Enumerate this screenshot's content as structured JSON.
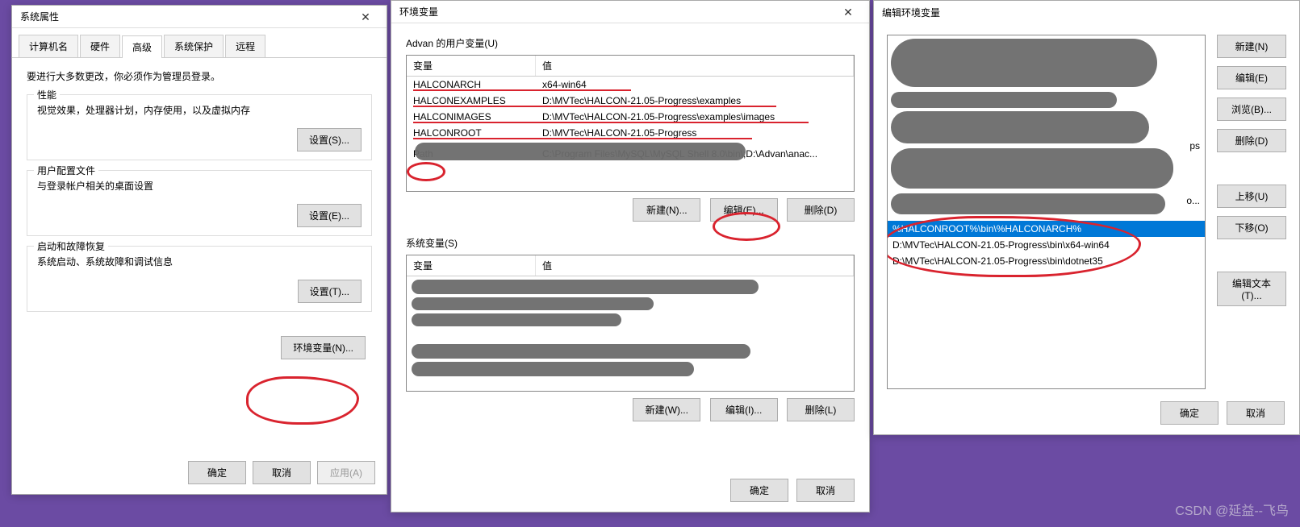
{
  "d1": {
    "title": "系统属性",
    "tabs": [
      "计算机名",
      "硬件",
      "高级",
      "系统保护",
      "远程"
    ],
    "intro": "要进行大多数更改，你必须作为管理员登录。",
    "perf": {
      "label": "性能",
      "desc": "视觉效果，处理器计划，内存使用，以及虚拟内存",
      "btn": "设置(S)..."
    },
    "profile": {
      "label": "用户配置文件",
      "desc": "与登录帐户相关的桌面设置",
      "btn": "设置(E)..."
    },
    "startup": {
      "label": "启动和故障恢复",
      "desc": "系统启动、系统故障和调试信息",
      "btn": "设置(T)..."
    },
    "env_btn": "环境变量(N)...",
    "ok": "确定",
    "cancel": "取消",
    "apply": "应用(A)"
  },
  "d2": {
    "title": "环境变量",
    "user_label": "Advan 的用户变量(U)",
    "col_name": "变量",
    "col_value": "值",
    "user_vars": [
      {
        "name": "HALCONARCH",
        "value": "x64-win64"
      },
      {
        "name": "HALCONEXAMPLES",
        "value": "D:\\MVTec\\HALCON-21.05-Progress\\examples"
      },
      {
        "name": "HALCONIMAGES",
        "value": "D:\\MVTec\\HALCON-21.05-Progress\\examples\\images"
      },
      {
        "name": "HALCONROOT",
        "value": "D:\\MVTec\\HALCON-21.05-Progress"
      },
      {
        "name": "",
        "value": ""
      },
      {
        "name": "Path",
        "value": "C:\\Program Files\\MySQL\\MySQL Shell 8.0\\bin\\;D:\\Advan\\anac..."
      }
    ],
    "btns_user": {
      "new": "新建(N)...",
      "edit": "编辑(E)...",
      "delete": "删除(D)"
    },
    "sys_label": "系统变量(S)",
    "btns_sys": {
      "new": "新建(W)...",
      "edit": "编辑(I)...",
      "delete": "删除(L)"
    },
    "ok": "确定",
    "cancel": "取消"
  },
  "d3": {
    "title": "编辑环境变量",
    "paths_visible_suffix": [
      "ps",
      "o..."
    ],
    "paths_full": [
      "%HALCONROOT%\\bin\\%HALCONARCH%",
      "D:\\MVTec\\HALCON-21.05-Progress\\bin\\x64-win64",
      "D:\\MVTec\\HALCON-21.05-Progress\\bin\\dotnet35"
    ],
    "btns": {
      "new": "新建(N)",
      "edit": "编辑(E)",
      "browse": "浏览(B)...",
      "delete": "删除(D)",
      "up": "上移(U)",
      "down": "下移(O)",
      "edittext": "编辑文本(T)..."
    },
    "ok": "确定",
    "cancel": "取消"
  },
  "watermark": "CSDN @延益--飞鸟"
}
